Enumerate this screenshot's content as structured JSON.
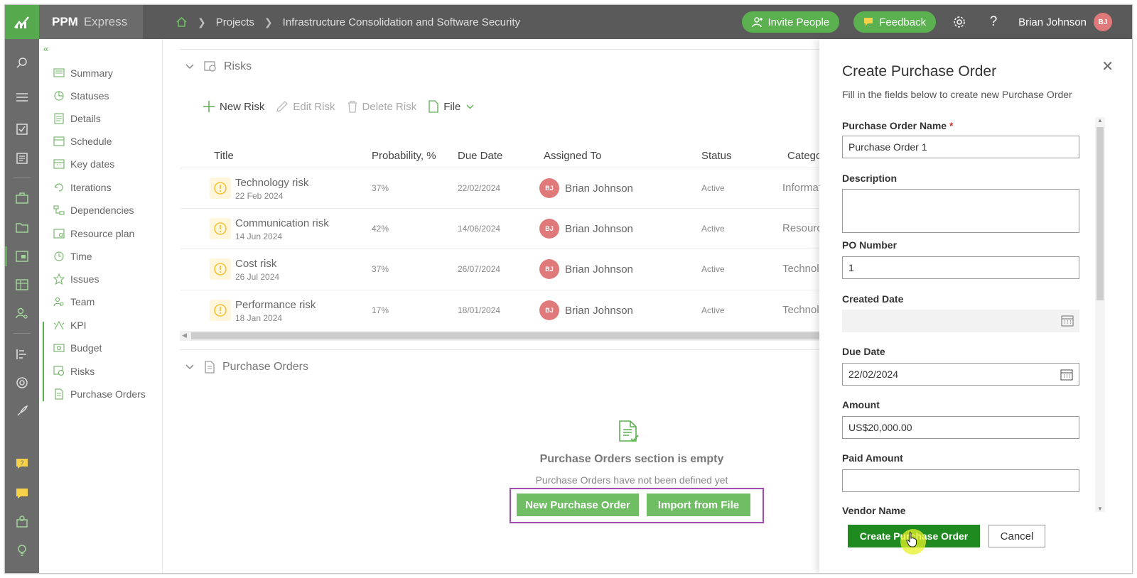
{
  "app": {
    "brand_strong": "PPM",
    "brand_light": "Express"
  },
  "breadcrumb": {
    "projects": "Projects",
    "project_name": "Infrastructure Consolidation and Software Security"
  },
  "header": {
    "invite_label": "Invite People",
    "feedback_label": "Feedback",
    "help_label": "?",
    "user_name": "Brian Johnson",
    "user_initials": "BJ"
  },
  "nav": {
    "items": [
      {
        "label": "Summary",
        "icon": "summary-icon"
      },
      {
        "label": "Statuses",
        "icon": "statuses-icon"
      },
      {
        "label": "Details",
        "icon": "details-icon"
      },
      {
        "label": "Schedule",
        "icon": "schedule-icon"
      },
      {
        "label": "Key dates",
        "icon": "calendar-icon"
      },
      {
        "label": "Iterations",
        "icon": "iterations-icon"
      },
      {
        "label": "Dependencies",
        "icon": "dependencies-icon"
      },
      {
        "label": "Resource plan",
        "icon": "resource-plan-icon"
      },
      {
        "label": "Time",
        "icon": "clock-icon"
      },
      {
        "label": "Issues",
        "icon": "star-icon"
      },
      {
        "label": "Team",
        "icon": "team-icon"
      },
      {
        "label": "KPI",
        "icon": "kpi-icon"
      },
      {
        "label": "Budget",
        "icon": "budget-icon"
      },
      {
        "label": "Risks",
        "icon": "risks-icon"
      },
      {
        "label": "Purchase Orders",
        "icon": "purchase-orders-icon"
      }
    ]
  },
  "risks": {
    "title": "Risks",
    "toolbar": {
      "new": "New Risk",
      "edit": "Edit Risk",
      "delete": "Delete Risk",
      "file": "File"
    },
    "columns": [
      "Title",
      "Probability, %",
      "Due Date",
      "Assigned To",
      "Status",
      "Categor"
    ],
    "rows": [
      {
        "title": "Technology risk",
        "date_sub": "22 Feb 2024",
        "probability": "37%",
        "due": "22/02/2024",
        "assignee": "Brian Johnson",
        "initials": "BJ",
        "status": "Active",
        "category": "Informat"
      },
      {
        "title": "Communication risk",
        "date_sub": "14 Jun 2024",
        "probability": "42%",
        "due": "14/06/2024",
        "assignee": "Brian Johnson",
        "initials": "BJ",
        "status": "Active",
        "category": "Resource"
      },
      {
        "title": "Cost risk",
        "date_sub": "26 Jul 2024",
        "probability": "37%",
        "due": "26/07/2024",
        "assignee": "Brian Johnson",
        "initials": "BJ",
        "status": "Active",
        "category": "Technolo"
      },
      {
        "title": "Performance risk",
        "date_sub": "18 Jan 2024",
        "probability": "17%",
        "due": "18/01/2024",
        "assignee": "Brian Johnson",
        "initials": "BJ",
        "status": "Active",
        "category": "Technolo"
      }
    ]
  },
  "purchase_orders": {
    "title": "Purchase Orders",
    "empty_title": "Purchase Orders section is empty",
    "empty_sub": "Purchase Orders have not been defined yet",
    "new_button": "New Purchase Order",
    "import_button": "Import from File"
  },
  "panel": {
    "title": "Create Purchase Order",
    "subtitle": "Fill in the fields below to create new Purchase Order",
    "fields": {
      "name_label": "Purchase Order Name",
      "required_mark": "*",
      "name_value": "Purchase Order 1",
      "description_label": "Description",
      "description_value": "",
      "po_number_label": "PO Number",
      "po_number_value": "1",
      "created_date_label": "Created Date",
      "created_date_value": "",
      "due_date_label": "Due Date",
      "due_date_value": "22/02/2024",
      "amount_label": "Amount",
      "amount_value": "US$20,000.00",
      "paid_amount_label": "Paid Amount",
      "paid_amount_value": "",
      "vendor_name_label": "Vendor Name"
    },
    "create_button": "Create Purchase Order",
    "cancel_button": "Cancel"
  },
  "colors": {
    "accent_green": "#5bb14f",
    "primary_green": "#1f8a1f",
    "highlight_purple": "#a34bb0",
    "avatar_red": "#e07a7a"
  }
}
